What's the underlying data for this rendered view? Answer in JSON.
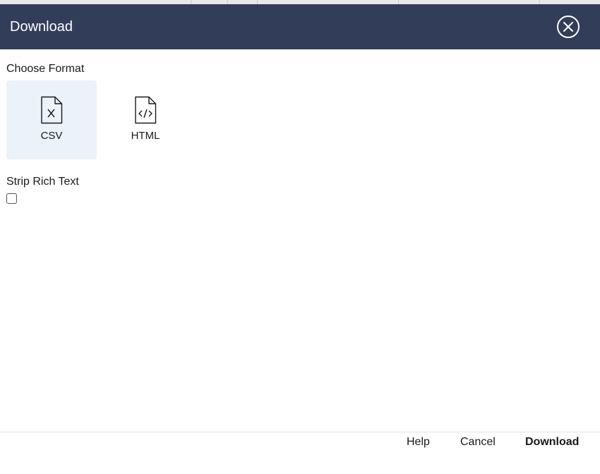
{
  "dialog": {
    "title": "Download",
    "close_icon": "close-circle-icon"
  },
  "format": {
    "label": "Choose Format",
    "options": [
      {
        "label": "CSV",
        "icon": "file-csv-icon",
        "selected": true
      },
      {
        "label": "HTML",
        "icon": "file-code-icon",
        "selected": false
      }
    ]
  },
  "strip_rich_text": {
    "label": "Strip Rich Text",
    "checked": false
  },
  "footer": {
    "help_label": "Help",
    "cancel_label": "Cancel",
    "download_label": "Download"
  },
  "colors": {
    "header_bg": "#323d5a",
    "selected_tile_bg": "#ebf2f9"
  }
}
